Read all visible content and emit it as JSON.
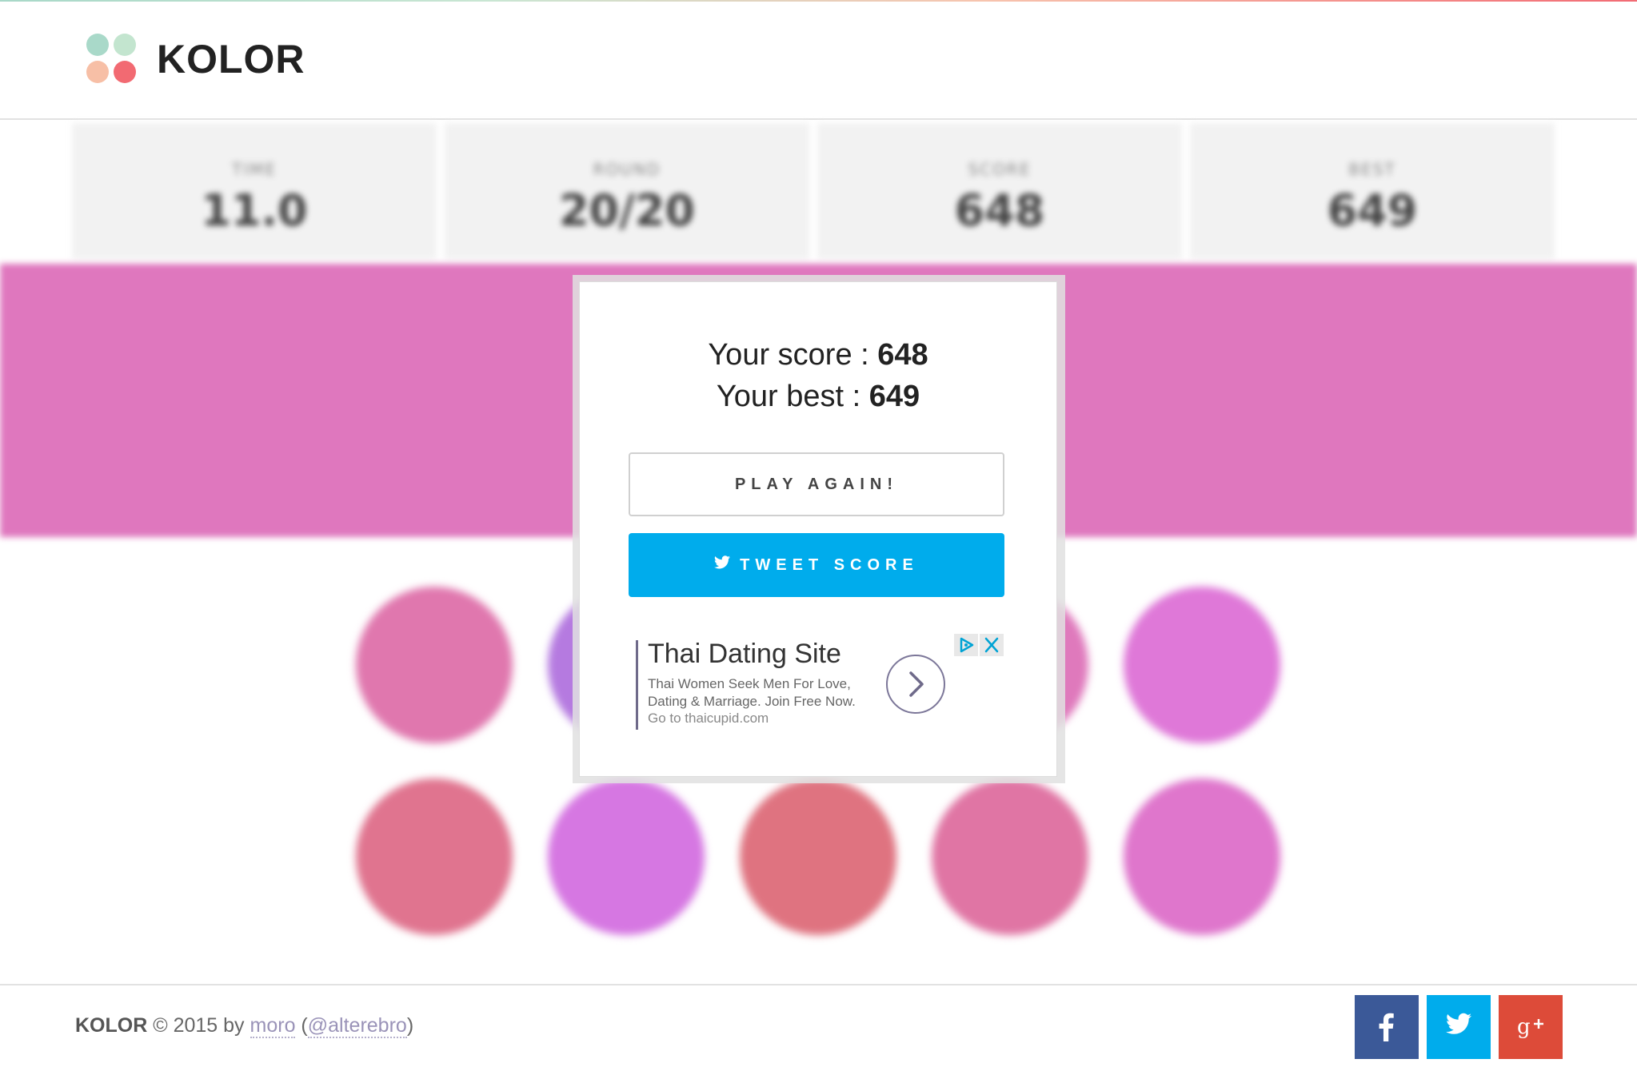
{
  "header": {
    "brand": "KOLOR",
    "logo_colors": [
      "#a9d9c9",
      "#c3e5cf",
      "#f7bfa6",
      "#f26a72"
    ]
  },
  "stats": [
    {
      "label": "TIME",
      "value": "11.0"
    },
    {
      "label": "ROUND",
      "value": "20/20"
    },
    {
      "label": "SCORE",
      "value": "648"
    },
    {
      "label": "BEST",
      "value": "649"
    }
  ],
  "game": {
    "band_color": "#df77be",
    "circle_colors": [
      "#e077ae",
      "#b57ae0",
      "#dd7ac0",
      "#df79bc",
      "#df78d8",
      "#e0748f",
      "#d677e2",
      "#df7380",
      "#e075a4",
      "#df76cc"
    ]
  },
  "modal": {
    "score_label": "Your score : ",
    "score_value": "648",
    "best_label": "Your best : ",
    "best_value": "649",
    "play_again_label": "PLAY AGAIN!",
    "tweet_label": "TWEET SCORE",
    "tweet_color": "#00acec"
  },
  "ad": {
    "title": "Thai Dating Site",
    "description": "Thai Women Seek Men For Love, Dating & Marriage. Join Free Now.",
    "url_text": "Go to thaicupid.com",
    "adchoices_icon": "adchoices-icon",
    "close_icon": "close-icon"
  },
  "footer": {
    "brand": "KOLOR",
    "copyright": " © 2015 by ",
    "author": "moro",
    "open_paren": " (",
    "handle": "@alterebro",
    "close_paren": ")",
    "social": [
      {
        "name": "facebook",
        "icon": "facebook-icon",
        "color": "#3b5998"
      },
      {
        "name": "twitter",
        "icon": "twitter-icon",
        "color": "#00acec"
      },
      {
        "name": "google-plus",
        "icon": "google-plus-icon",
        "color": "#dd4b39"
      }
    ]
  }
}
